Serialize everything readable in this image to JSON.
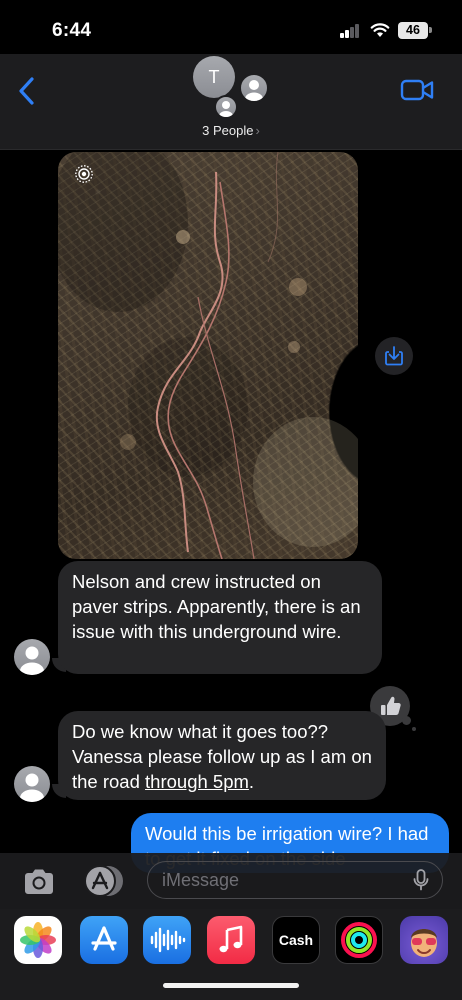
{
  "status_bar": {
    "time": "6:44",
    "battery": "46"
  },
  "header": {
    "avatar_initial": "T",
    "participants_label": "3 People",
    "chevron": "›",
    "back_icon": "chevron-left-icon",
    "video_icon": "video-camera-icon"
  },
  "messages": [
    {
      "sender": "other",
      "type": "photo",
      "icons": [
        "live-photo-icon",
        "save-to-photos-icon"
      ]
    },
    {
      "sender": "other",
      "type": "text",
      "text": "Nelson and crew instructed on paver strips. Apparently, there is an issue with this underground wire."
    },
    {
      "sender": "other",
      "type": "text",
      "text_before_link": "Do we know what it goes too?? Vanessa please follow up as I am on the road ",
      "link_text": "through 5pm",
      "text_after_link": ".",
      "tapback": "thumbs-up-icon"
    },
    {
      "sender": "me",
      "type": "text",
      "text": "Would this be irrigation wire? I had to get it fixed on the side"
    }
  ],
  "input_bar": {
    "placeholder": "iMessage",
    "value": ""
  },
  "app_drawer": {
    "apps": [
      "Photos",
      "App Store",
      "Audio Message",
      "Music",
      "Cash",
      "Fitness",
      "Memoji"
    ],
    "cash_label": "Cash",
    "apple_glyph": ""
  },
  "colors": {
    "outgoing_bubble": "#1e7ef0",
    "incoming_bubble": "#262628",
    "accent": "#1e7ef0"
  }
}
